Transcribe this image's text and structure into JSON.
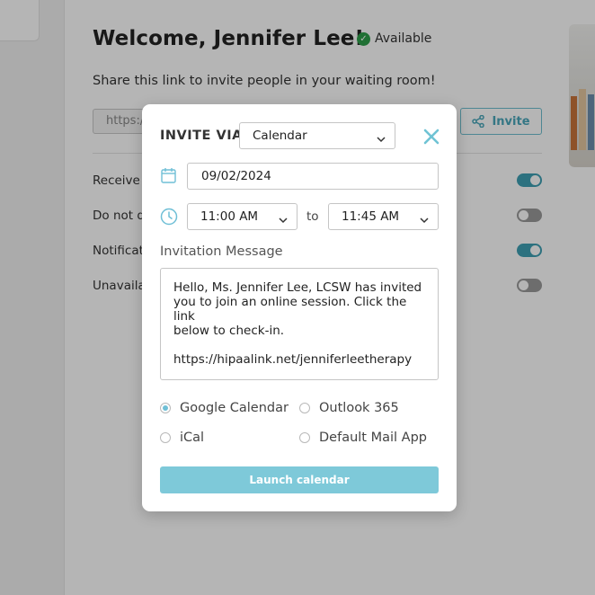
{
  "header": {
    "welcome": "Welcome, Jennifer Lee!",
    "status": "Available",
    "status_color": "#2e9e4a"
  },
  "share": {
    "text": "Share this link to invite people in your waiting room!",
    "link_value": "https://",
    "invite_label": "Invite"
  },
  "settings": [
    {
      "label": "Receive v",
      "enabled": true
    },
    {
      "label": "Do not d",
      "enabled": false
    },
    {
      "label": "Notificat",
      "enabled": true
    },
    {
      "label": "Unavaila",
      "enabled": false
    }
  ],
  "modal": {
    "title": "INVITE VIA",
    "via_selected": "Calendar",
    "date": "09/02/2024",
    "time_from": "11:00 AM",
    "to_label": "to",
    "time_to": "11:45 AM",
    "message_label": "Invitation Message",
    "message_lines": [
      "Hello, Ms. Jennifer Lee, LCSW has invited",
      "you to join an online session. Click the link",
      "below to check-in."
    ],
    "message_link": "https://hipaalink.net/jenniferleetherapy",
    "options": [
      {
        "label": "Google Calendar",
        "checked": true
      },
      {
        "label": "Outlook 365",
        "checked": false
      },
      {
        "label": "iCal",
        "checked": false
      },
      {
        "label": "Default Mail App",
        "checked": false
      }
    ],
    "launch_label": "Launch calendar"
  },
  "colors": {
    "accent": "#6fbfcf",
    "toggle_on": "#3e9fb3",
    "button": "#7ec9d9"
  }
}
